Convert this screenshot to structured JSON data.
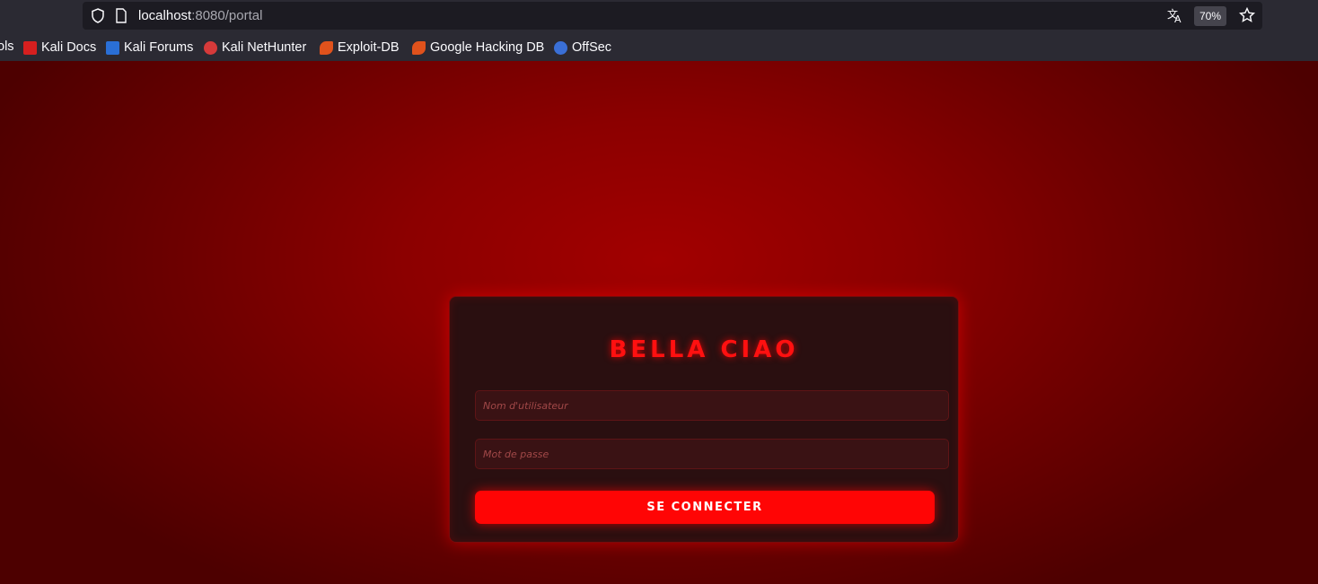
{
  "browser": {
    "url_host": "localhost",
    "url_rest": ":8080/portal",
    "zoom": "70%",
    "bookmarks": {
      "partial_label": "ols",
      "items": [
        {
          "label": "Kali Docs",
          "icon": "kali-docs-icon",
          "color": "#d61f1f"
        },
        {
          "label": "Kali Forums",
          "icon": "kali-forums-icon",
          "color": "#2a6fd6"
        },
        {
          "label": "Kali NetHunter",
          "icon": "kali-nethunter-icon",
          "color": "#d63a3a"
        },
        {
          "label": "Exploit-DB",
          "icon": "exploit-db-icon",
          "color": "#e0521c"
        },
        {
          "label": "Google Hacking DB",
          "icon": "ghdb-icon",
          "color": "#e0521c"
        },
        {
          "label": "OffSec",
          "icon": "offsec-icon",
          "color": "#3a6fd6"
        }
      ]
    }
  },
  "login": {
    "title": "BELLA CIAO",
    "username_placeholder": "Nom d'utilisateur",
    "password_placeholder": "Mot de passe",
    "submit_label": "SE CONNECTER"
  },
  "colors": {
    "accent": "#ff0505",
    "card_bg": "#2a0f10",
    "page_bg_center": "#a20000"
  }
}
